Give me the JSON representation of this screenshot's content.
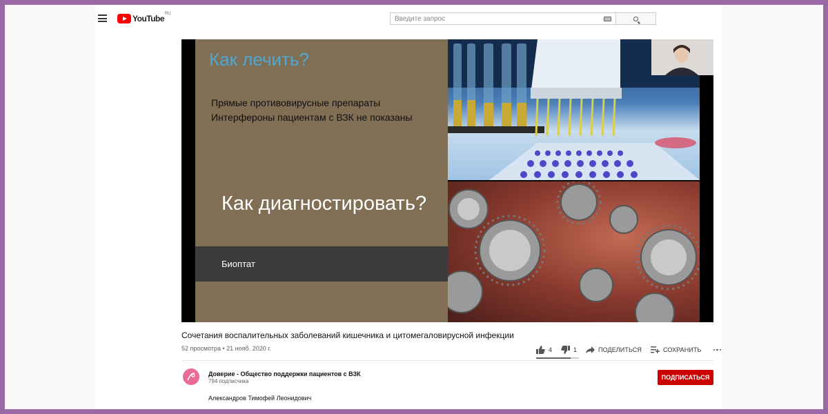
{
  "header": {
    "logo_text": "YouTube",
    "logo_region": "RU",
    "search_placeholder": "Введите запрос"
  },
  "slide": {
    "heading": "Как лечить?",
    "bullets": [
      "Прямые противовирусные препараты",
      "Интерфероны пациентам с ВЗК не показаны"
    ],
    "big_text": "Как диагностировать?",
    "bar_text": "Биоптат"
  },
  "video": {
    "title": "Сочетания воспалительных заболеваний кишечника и цитомегаловирусной инфекции",
    "meta": "52 просмотра • 21 нояб. 2020 г.",
    "likes": "4",
    "dislikes": "1",
    "share_label": "ПОДЕЛИТЬСЯ",
    "save_label": "СОХРАНИТЬ",
    "like_ratio": 0.8
  },
  "channel": {
    "name": "Доверие - Общество поддержки пациентов с ВЗК",
    "subscribers": "794 подписчика",
    "subscribe_label": "ПОДПИСАТЬСЯ"
  },
  "description": {
    "text": "Александров Тимофей Леонидович"
  },
  "colors": {
    "background_border": "#9b6aa6",
    "subscribe": "#cc0000",
    "slide_bg": "#806e55",
    "slide_heading": "#4fa8d3",
    "logo_red": "#ff0000"
  }
}
